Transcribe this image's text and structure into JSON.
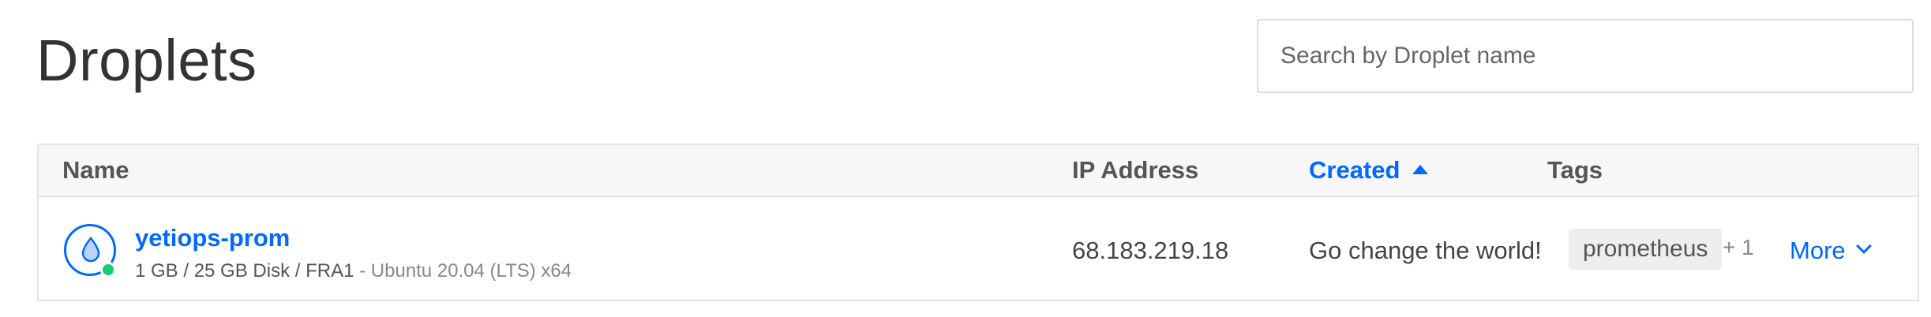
{
  "page": {
    "title": "Droplets"
  },
  "search": {
    "placeholder": "Search by Droplet name"
  },
  "table": {
    "columns": {
      "name": "Name",
      "ip": "IP Address",
      "created": "Created",
      "tags": "Tags"
    },
    "sort": {
      "column": "created",
      "direction": "ascending"
    },
    "rows": [
      {
        "name": "yetiops-prom",
        "specs": "1 GB / 25 GB Disk / FRA1",
        "separator": " - ",
        "os": "Ubuntu 20.04 (LTS) x64",
        "status": "active",
        "status_color": "#15cd72",
        "ip": "68.183.219.18",
        "created": "Go change the world!",
        "tag": "prometheus",
        "extra_tags": "+ 1",
        "action": "More"
      }
    ]
  },
  "colors": {
    "accent": "#0069ff",
    "status_active": "#15cd72"
  },
  "icons": {
    "droplet": "droplet-icon",
    "sort": "sort-ascending-icon",
    "more": "chevron-down-icon"
  }
}
